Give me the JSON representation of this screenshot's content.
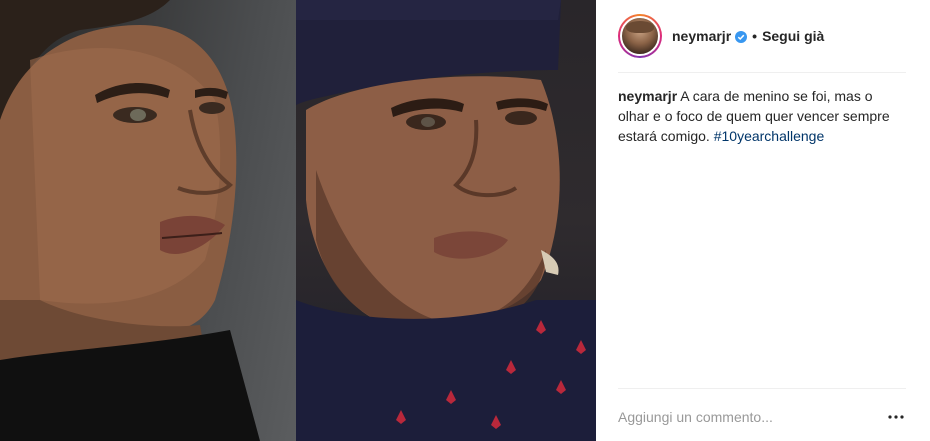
{
  "post": {
    "username": "neymarjr",
    "follow_state": "Segui già",
    "separator": "•",
    "caption_text": "A cara de menino se foi, mas o olhar e o foco de quem quer vencer sempre estará comigo. ",
    "hashtag": "#10yearchallenge",
    "comment_placeholder": "Aggiungi un commento...",
    "more_label": "•••"
  },
  "icons": {
    "verified": "verified-badge-icon",
    "more": "more-options-icon"
  },
  "colors": {
    "hashtag": "#003569",
    "verified": "#3897f0",
    "text": "#262626",
    "placeholder": "#999999"
  }
}
